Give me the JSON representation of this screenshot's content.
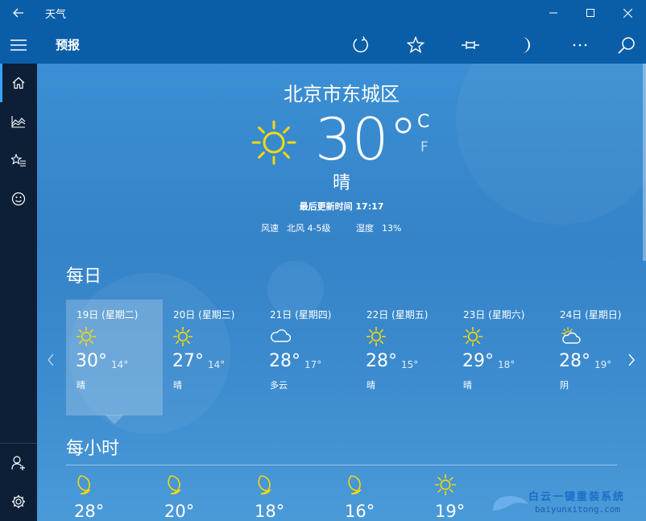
{
  "window": {
    "title": "天气"
  },
  "command_bar": {
    "title": "预报"
  },
  "current": {
    "location": "北京市东城区",
    "temperature": "30",
    "degree": "°",
    "unit_c": "C",
    "unit_f": "F",
    "condition": "晴",
    "updated": "最后更新时间 17:17",
    "wind_label": "风速",
    "wind_value": "北风 4-5级",
    "humidity_label": "湿度",
    "humidity_value": "13%"
  },
  "daily_title": "每日",
  "hourly_title": "每小时",
  "daily": [
    {
      "label": "19日 (星期二)",
      "icon": "sun-icon",
      "hi": "30°",
      "lo": "14°",
      "cond": "晴",
      "selected": true
    },
    {
      "label": "20日 (星期三)",
      "icon": "sun-icon",
      "hi": "27°",
      "lo": "14°",
      "cond": "晴"
    },
    {
      "label": "21日 (星期四)",
      "icon": "cloud-icon",
      "hi": "28°",
      "lo": "17°",
      "cond": "多云"
    },
    {
      "label": "22日 (星期五)",
      "icon": "sun-icon",
      "hi": "28°",
      "lo": "15°",
      "cond": "晴"
    },
    {
      "label": "23日 (星期六)",
      "icon": "sun-icon",
      "hi": "29°",
      "lo": "18°",
      "cond": "晴"
    },
    {
      "label": "24日 (星期日)",
      "icon": "partly-cloudy-icon",
      "hi": "28°",
      "lo": "19°",
      "cond": "阴"
    }
  ],
  "hourly": [
    {
      "icon": "moon-icon",
      "temp": "28°"
    },
    {
      "icon": "moon-icon",
      "temp": "20°"
    },
    {
      "icon": "moon-icon",
      "temp": "18°"
    },
    {
      "icon": "moon-icon",
      "temp": "16°"
    },
    {
      "icon": "sun-icon",
      "temp": "19°"
    }
  ],
  "watermark": {
    "line1": "白云一键重装系统",
    "line2": "baiyunxitong.com"
  },
  "colors": {
    "titlebar": "#0a5ea8",
    "nav": "#0c1f36",
    "sun": "#f5d90a",
    "accent": "#3aa0ff"
  }
}
